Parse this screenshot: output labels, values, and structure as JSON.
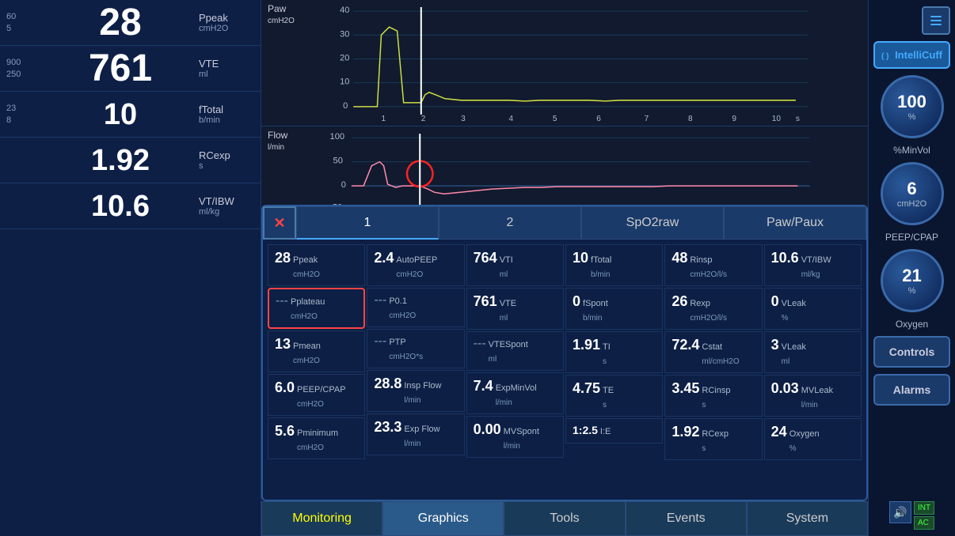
{
  "vitals": [
    {
      "range_high": "60",
      "range_low": "5",
      "value": "28",
      "label": "Ppeak",
      "unit": "cmH2O"
    },
    {
      "range_high": "900",
      "range_low": "250",
      "value": "761",
      "label": "VTE",
      "unit": "ml"
    },
    {
      "range_high": "23",
      "range_low": "8",
      "value": "10",
      "label": "fTotal",
      "unit": "b/min"
    },
    {
      "range_high": "",
      "range_low": "",
      "value": "1.92",
      "label": "RCexp",
      "unit": "s"
    },
    {
      "range_high": "",
      "range_low": "",
      "value": "10.6",
      "label": "VT/IBW",
      "unit": "ml/kg"
    }
  ],
  "charts": {
    "paw": {
      "label": "Paw",
      "unit": "cmH2O",
      "ymax": 40,
      "ymin": 0
    },
    "flow": {
      "label": "Flow",
      "unit": "l/min",
      "ymax": 100,
      "ymin": -100
    }
  },
  "monitoring_tabs": [
    {
      "label": "1",
      "active": true
    },
    {
      "label": "2",
      "active": false
    },
    {
      "label": "SpO2raw",
      "active": false
    },
    {
      "label": "Paw/Paux",
      "active": false
    }
  ],
  "monitoring_data": [
    [
      {
        "value": "28",
        "label": "Ppeak",
        "unit": "cmH2O"
      },
      {
        "value": "---",
        "label": "Pplateau",
        "unit": "cmH2O",
        "highlighted": true
      },
      {
        "value": "13",
        "label": "Pmean",
        "unit": "cmH2O"
      },
      {
        "value": "6.0",
        "label": "PEEP/CPAP",
        "unit": "cmH2O"
      },
      {
        "value": "5.6",
        "label": "Pminimum",
        "unit": "cmH2O"
      }
    ],
    [
      {
        "value": "2.4",
        "label": "AutoPEEP",
        "unit": "cmH2O"
      },
      {
        "value": "---",
        "label": "P0.1",
        "unit": "cmH2O"
      },
      {
        "value": "---",
        "label": "PTP",
        "unit": "cmH2O*s"
      },
      {
        "value": "28.8",
        "label": "Insp Flow",
        "unit": "l/min"
      },
      {
        "value": "23.3",
        "label": "Exp Flow",
        "unit": "l/min"
      }
    ],
    [
      {
        "value": "764",
        "label": "VTI",
        "unit": "ml"
      },
      {
        "value": "761",
        "label": "VTE",
        "unit": "ml"
      },
      {
        "value": "---",
        "label": "VTESpont",
        "unit": "ml"
      },
      {
        "value": "7.4",
        "label": "ExpMinVol",
        "unit": "l/min"
      },
      {
        "value": "0.00",
        "label": "MVSpont",
        "unit": "l/min"
      }
    ],
    [
      {
        "value": "10",
        "label": "fTotal",
        "unit": "b/min"
      },
      {
        "value": "0",
        "label": "fSpont",
        "unit": "b/min"
      },
      {
        "value": "1.91",
        "label": "TI",
        "unit": "s"
      },
      {
        "value": "4.75",
        "label": "TE",
        "unit": "s"
      },
      {
        "value": "1:2.5",
        "label": "I:E",
        "unit": ""
      }
    ],
    [
      {
        "value": "48",
        "label": "Rinsp",
        "unit": "cmH2O/l/s"
      },
      {
        "value": "26",
        "label": "Rexp",
        "unit": "cmH2O/l/s"
      },
      {
        "value": "72.4",
        "label": "Cstat",
        "unit": "ml/cmH2O"
      },
      {
        "value": "3.45",
        "label": "RCinsp",
        "unit": "s"
      },
      {
        "value": "1.92",
        "label": "RCexp",
        "unit": "s"
      }
    ],
    [
      {
        "value": "10.6",
        "label": "VT/IBW",
        "unit": "ml/kg"
      },
      {
        "value": "0",
        "label": "VLeak",
        "unit": "%"
      },
      {
        "value": "3",
        "label": "VLeak",
        "unit": "ml"
      },
      {
        "value": "0.03",
        "label": "MVLeak",
        "unit": "l/min"
      },
      {
        "value": "24",
        "label": "Oxygen",
        "unit": "%"
      }
    ]
  ],
  "right_controls": {
    "intellicuff_label": "IntelliCuff",
    "minvol_value": "100",
    "minvol_unit": "%",
    "minvol_label": "%MinVol",
    "peep_value": "6",
    "peep_unit": "cmH2O",
    "peep_label": "PEEP/CPAP",
    "oxygen_value": "21",
    "oxygen_unit": "%",
    "oxygen_label": "Oxygen",
    "controls_label": "Controls",
    "alarms_label": "Alarms"
  },
  "bottom_nav": [
    {
      "label": "Monitoring",
      "active": true
    },
    {
      "label": "Graphics",
      "active": false
    },
    {
      "label": "Tools",
      "active": false
    },
    {
      "label": "Events",
      "active": false
    },
    {
      "label": "System",
      "active": false
    }
  ],
  "mode_buttons": [
    "INT",
    "AC"
  ]
}
